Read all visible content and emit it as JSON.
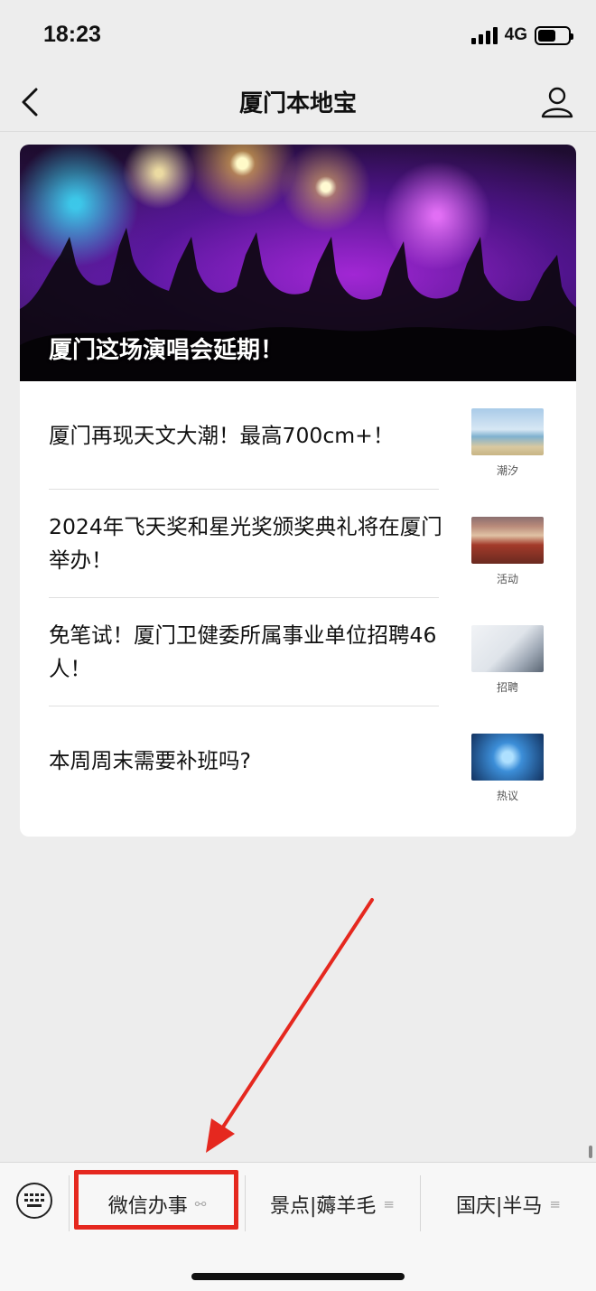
{
  "status_bar": {
    "time": "18:23",
    "network": "4G",
    "battery_level": 0.58
  },
  "nav": {
    "title": "厦门本地宝",
    "back_icon": "chevron-left-icon",
    "profile_icon": "person-icon"
  },
  "hero": {
    "title": "厦门这场演唱会延期！"
  },
  "articles": [
    {
      "title": "厦门再现天文大潮！最高700cm+！",
      "thumb_caption": "潮汐"
    },
    {
      "title": "2024年飞天奖和星光奖颁奖典礼将在厦门举办！",
      "thumb_caption": "活动"
    },
    {
      "title": "免笔试！厦门卫健委所属事业单位招聘46人！",
      "thumb_caption": "招聘"
    },
    {
      "title": "本周周末需要补班吗?",
      "thumb_caption": "热议"
    }
  ],
  "bottom_menu": {
    "keyboard_icon": "keyboard-icon",
    "items": [
      {
        "label": "微信办事",
        "icon": "link-icon",
        "icon_glyph": "⚯"
      },
      {
        "label": "景点|薅羊毛",
        "icon": "menu-lines-icon",
        "icon_glyph": "≡"
      },
      {
        "label": "国庆|半马",
        "icon": "menu-lines-icon",
        "icon_glyph": "≡"
      }
    ]
  },
  "annotation": {
    "color": "#e5281f",
    "highlighted_item": "微信办事"
  }
}
